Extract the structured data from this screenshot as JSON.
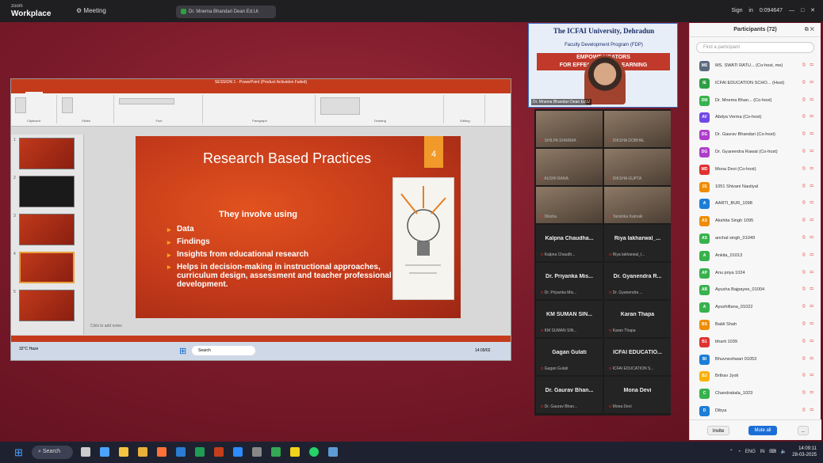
{
  "zoom": {
    "brand_top": "zoom",
    "brand": "Workplace",
    "meeting_label": "Meeting",
    "share_tab": "Dr. Mnema Bhandari Dean Ed.Ur.",
    "signin": "Sign in",
    "timer": "0:094647"
  },
  "ppt": {
    "window_title": "SESSION 1 - PowerPoint (Product Activation Failed)",
    "tabs": [
      "FILE",
      "HOME",
      "INSERT",
      "DESIGN",
      "TRANSITIONS",
      "ANIMATIONS",
      "SLIDE SHOW",
      "REVIEW",
      "VIEW",
      "Altium DXP Classification"
    ],
    "sign_in": "Sign in",
    "groups": [
      "Clipboard",
      "Slides",
      "Font",
      "Paragraph",
      "Drawing",
      "Editing"
    ],
    "thumb_numbers": [
      "1",
      "2",
      "3",
      "4",
      "5"
    ],
    "notes": "Click to add notes",
    "slide": {
      "title": "Research  Based Practices",
      "number": "4",
      "heading": "They involve using",
      "bullets": [
        "Data",
        "Findings",
        "Insights from educational research",
        "Helps in decision-making in instructional approaches, curriculum design, assessment and teacher professional development."
      ]
    },
    "taskbar_search": "Search",
    "taskbar_temp": "32°C Haze",
    "taskbar_time": "14:09/02"
  },
  "speaker": {
    "line1": "The ICFAI University, Dehradun",
    "line2": "Faculty Development Program (FDP)",
    "banner1": "EMPOWE        UCATORS",
    "banner2": "FOR EFFECTIVE          AND LEARNING",
    "name": "Dr. Mnema Bhandari Dean Ed.U"
  },
  "gallery": [
    {
      "title": "",
      "sub": "SHILPA SHARMA",
      "video": true
    },
    {
      "title": "",
      "sub": "DIKSHA DOBHAL",
      "video": true
    },
    {
      "title": "",
      "sub": "AUSHI RANA",
      "video": true
    },
    {
      "title": "",
      "sub": "DIKSHA GUPTA",
      "video": true
    },
    {
      "title": "",
      "sub": "Diksha",
      "video": true
    },
    {
      "title": "",
      "sub": "Tanishka Kamuki",
      "video": true
    },
    {
      "title": "Kalpna Chaudha...",
      "sub": "Kalpna Chaudh...",
      "video": false
    },
    {
      "title": "Riya lakharwal_...",
      "sub": "Riya lakharwal_I...",
      "video": false
    },
    {
      "title": "Dr. Priyanka Mis...",
      "sub": "Dr. Priyanka Mis...",
      "video": false
    },
    {
      "title": "Dr. Gyanendra R...",
      "sub": "Dr. Gyanendra ...",
      "video": false
    },
    {
      "title": "KM SUMAN SIN...",
      "sub": "KM SUMAN SIN...",
      "video": false
    },
    {
      "title": "Karan Thapa",
      "sub": "Karan Thapa",
      "video": false
    },
    {
      "title": "Gagan Gulati",
      "sub": "Gagan Gulati",
      "video": false
    },
    {
      "title": "ICFAI EDUCATIO...",
      "sub": "ICFAI EDUCATION S...",
      "video": false
    },
    {
      "title": "Dr. Gaurav Bhan...",
      "sub": "Dr. Gaurav Bhan...",
      "video": false
    },
    {
      "title": "Mona Devi",
      "sub": "Mona Devi",
      "video": false
    }
  ],
  "participants": {
    "header": "Participants (72)",
    "search_placeholder": "Find a participant",
    "list": [
      {
        "initials": "MS",
        "name": "MS. SWATI RATU... (Co-host, me)",
        "color": "#5b6b7c"
      },
      {
        "initials": "IE",
        "name": "ICFAI EDUCATION SCHO... (Host)",
        "color": "#2f9e44"
      },
      {
        "initials": "DM",
        "name": "Dr. Mnema Bhan... (Co-host)",
        "color": "#37b24d"
      },
      {
        "initials": "AV",
        "name": "Abdya Verma (Co-host)",
        "color": "#7048e8"
      },
      {
        "initials": "DG",
        "name": "Dr. Gaurav Bhandari (Co-host)",
        "color": "#ae3ec9"
      },
      {
        "initials": "DG",
        "name": "Dr. Gyanendra Rawat (Co-host)",
        "color": "#ae3ec9"
      },
      {
        "initials": "MD",
        "name": "Mona Devi (Co-host)",
        "color": "#e03131"
      },
      {
        "initials": "1S",
        "name": "1051 Shivani Nautiyal",
        "color": "#f08c00"
      },
      {
        "initials": "A",
        "name": "AARTI_BUR_1098",
        "color": "#1c7ed6"
      },
      {
        "initials": "AS",
        "name": "Akshita Singh 1095",
        "color": "#f08c00"
      },
      {
        "initials": "AS",
        "name": "anchal singh_01049",
        "color": "#37b24d"
      },
      {
        "initials": "A",
        "name": "Ankita_01013",
        "color": "#37b24d"
      },
      {
        "initials": "AP",
        "name": "Anu priya 1024",
        "color": "#37b24d"
      },
      {
        "initials": "AB",
        "name": "Ayusha Bajpayee_01004",
        "color": "#37b24d"
      },
      {
        "initials": "A",
        "name": "Ayushifiana_01022",
        "color": "#37b24d"
      },
      {
        "initials": "BS",
        "name": "Babli Shah",
        "color": "#f08c00"
      },
      {
        "initials": "B1",
        "name": "bharti 1039",
        "color": "#e03131"
      },
      {
        "initials": "BI",
        "name": "Bhuvneshwari 01053",
        "color": "#1c7ed6"
      },
      {
        "initials": "BJ",
        "name": "Brthav Jyoti",
        "color": "#fab005"
      },
      {
        "initials": "C",
        "name": "Chandrakala_1023",
        "color": "#37b24d"
      },
      {
        "initials": "D",
        "name": "Dibya",
        "color": "#1c7ed6"
      }
    ],
    "invite": "Invite",
    "mute_all": "Mute all",
    "more": "..."
  },
  "taskbar": {
    "search": "Search",
    "lang": "ENG IN",
    "time": "14:09:11",
    "date": "28-03-2025"
  }
}
